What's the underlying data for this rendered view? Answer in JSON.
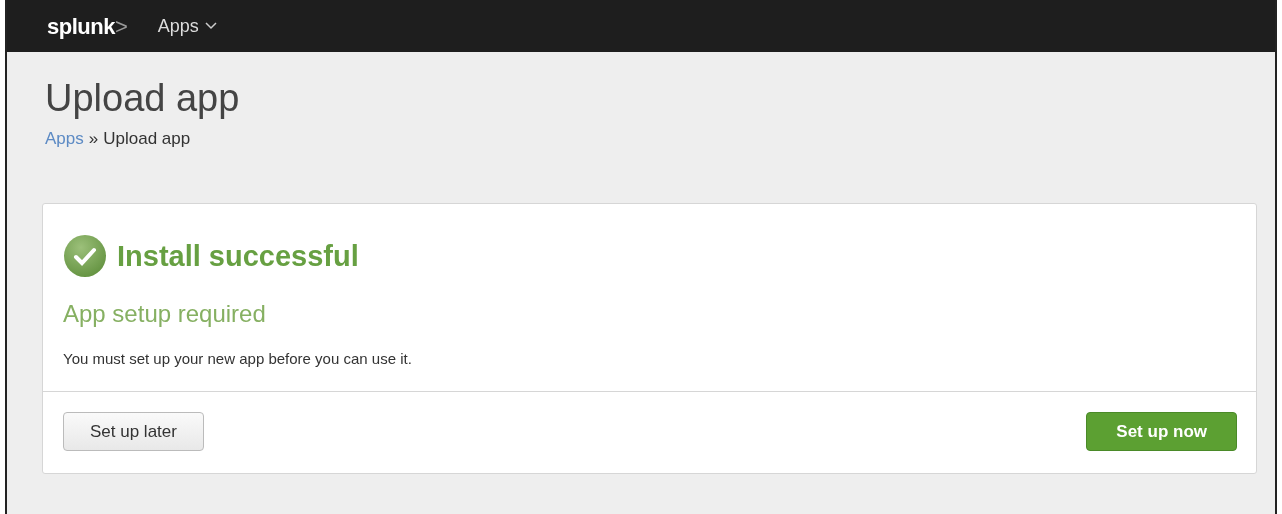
{
  "navbar": {
    "logo": {
      "word": "splunk",
      "mark": ">"
    },
    "menu": {
      "label": "Apps"
    }
  },
  "page": {
    "title": "Upload app",
    "breadcrumb": [
      {
        "label": "Apps",
        "kind": "link"
      },
      {
        "label": "»",
        "kind": "separator"
      },
      {
        "label": "Upload app",
        "kind": "current"
      }
    ]
  },
  "panel": {
    "heading": "Install successful",
    "subheading": "App setup required",
    "message": "You must set up your new app before you can use it.",
    "buttons": [
      {
        "label": "Set up later",
        "kind": "secondary"
      },
      {
        "label": "Set up now",
        "kind": "primary"
      }
    ]
  }
}
